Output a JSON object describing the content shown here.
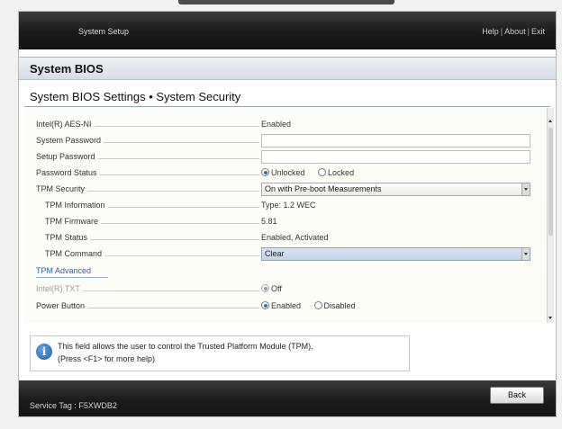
{
  "header": {
    "app_title": "System Setup",
    "links": [
      "Help",
      "About",
      "Exit"
    ]
  },
  "section_title": "System BIOS",
  "page_title": "System BIOS Settings • System Security",
  "settings": {
    "aes_ni": {
      "label": "Intel(R) AES-NI",
      "value": "Enabled"
    },
    "system_password": {
      "label": "System Password",
      "value": ""
    },
    "setup_password": {
      "label": "Setup Password",
      "value": ""
    },
    "password_status": {
      "label": "Password Status",
      "options": [
        "Unlocked",
        "Locked"
      ],
      "selected": "Unlocked"
    },
    "tpm_security": {
      "label": "TPM Security",
      "value": "On with Pre-boot Measurements"
    },
    "tpm_information": {
      "label": "TPM Information",
      "value": "Type: 1.2  WEC"
    },
    "tpm_firmware": {
      "label": "TPM Firmware",
      "value": "5.81"
    },
    "tpm_status": {
      "label": "TPM Status",
      "value": "Enabled, Activated"
    },
    "tpm_command": {
      "label": "TPM Command",
      "value": "Clear"
    },
    "tpm_advanced": {
      "label": "TPM Advanced"
    },
    "intel_txt": {
      "label": "Intel(R) TXT",
      "value": "Off"
    },
    "power_button": {
      "label": "Power Button",
      "options": [
        "Enabled",
        "Disabled"
      ],
      "selected": "Enabled"
    }
  },
  "help": {
    "line1": "This field allows the user to control the Trusted Platform Module (TPM).",
    "line2": "(Press <F1> for more help)"
  },
  "footer": {
    "service_tag": "Service Tag : F5XWDB2",
    "back_label": "Back"
  },
  "colors": {
    "accent": "#2d6fb3",
    "link": "#2d62a3",
    "header_bg": "#1a1a1a",
    "highlight_select": "#c3d5ea"
  },
  "icons": [
    "info-icon",
    "dropdown-arrow-icon",
    "scroll-up-icon",
    "scroll-down-icon"
  ]
}
